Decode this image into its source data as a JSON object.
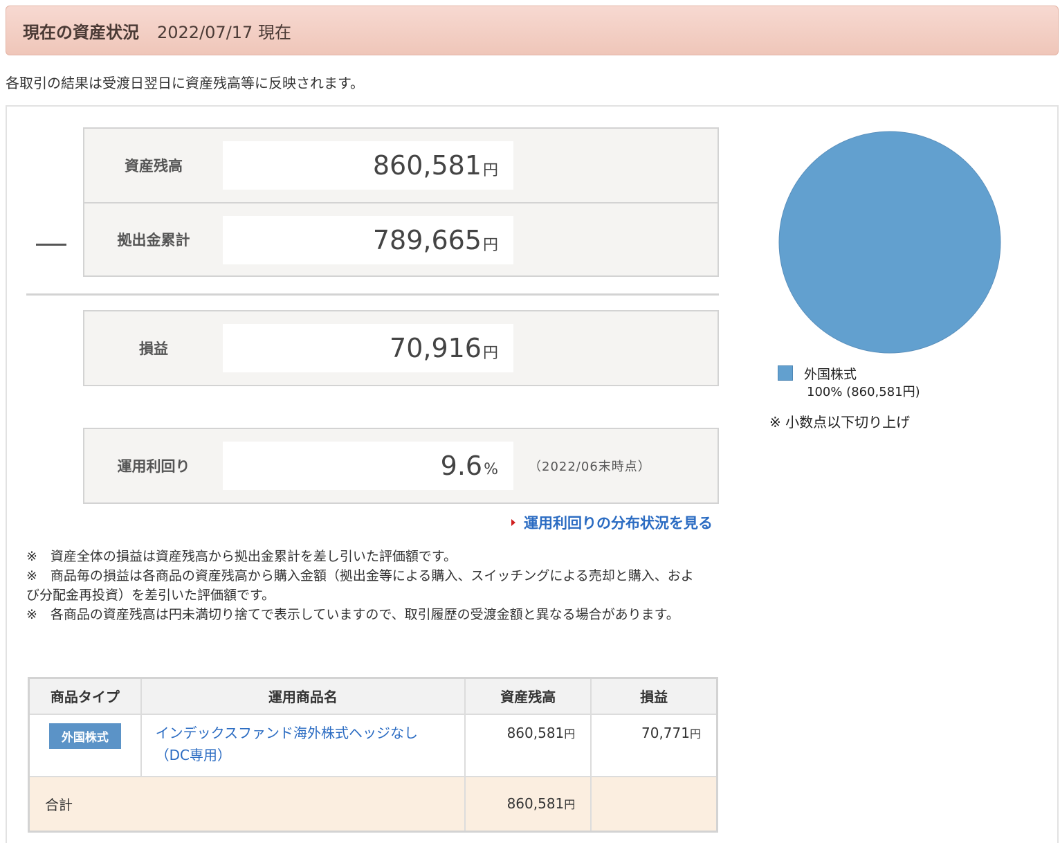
{
  "header": {
    "title": "現在の資産状況",
    "date": "2022/07/17 現在"
  },
  "notice": "各取引の結果は受渡日翌日に資産残高等に反映されます。",
  "summary": {
    "balance": {
      "label": "資産残高",
      "value": "860,581",
      "unit": "円"
    },
    "contributions": {
      "label": "拠出金累計",
      "value": "789,665",
      "unit": "円"
    },
    "profit": {
      "label": "損益",
      "value": "70,916",
      "unit": "円"
    },
    "yield": {
      "label": "運用利回り",
      "value": "9.6",
      "unit": "%",
      "note": "（2022/06末時点）"
    }
  },
  "distribution_link": "運用利回りの分布状況を見る",
  "notes": [
    "※　資産全体の損益は資産残高から拠出金累計を差し引いた評価額です。",
    "※　商品毎の損益は各商品の資産残高から購入金額（拠出金等による購入、スイッチングによる売却と購入、および分配金再投資）を差引いた評価額です。",
    "※　各商品の資産残高は円未満切り捨てで表示していますので、取引履歴の受渡金額と異なる場合があります。"
  ],
  "table": {
    "headers": [
      "商品タイプ",
      "運用商品名",
      "資産残高",
      "損益"
    ],
    "rows": [
      {
        "type": "外国株式",
        "name": "インデックスファンド海外株式ヘッジなし（DC専用）",
        "balance": "860,581",
        "profit": "70,771",
        "unit": "円"
      }
    ],
    "total": {
      "label": "合計",
      "balance": "860,581",
      "unit": "円"
    }
  },
  "chart_data": {
    "type": "pie",
    "categories": [
      "外国株式"
    ],
    "values": [
      100
    ],
    "colors": [
      "#62a0cf"
    ],
    "legend": [
      {
        "name": "外国株式",
        "detail": "100% (860,581円)"
      }
    ],
    "note": "※ 小数点以下切り上げ"
  },
  "colors": {
    "accent_link": "#2a6bc2",
    "header_bg": "#f3d0c5",
    "badge": "#5b93c7",
    "total_row": "#fbeee0"
  }
}
